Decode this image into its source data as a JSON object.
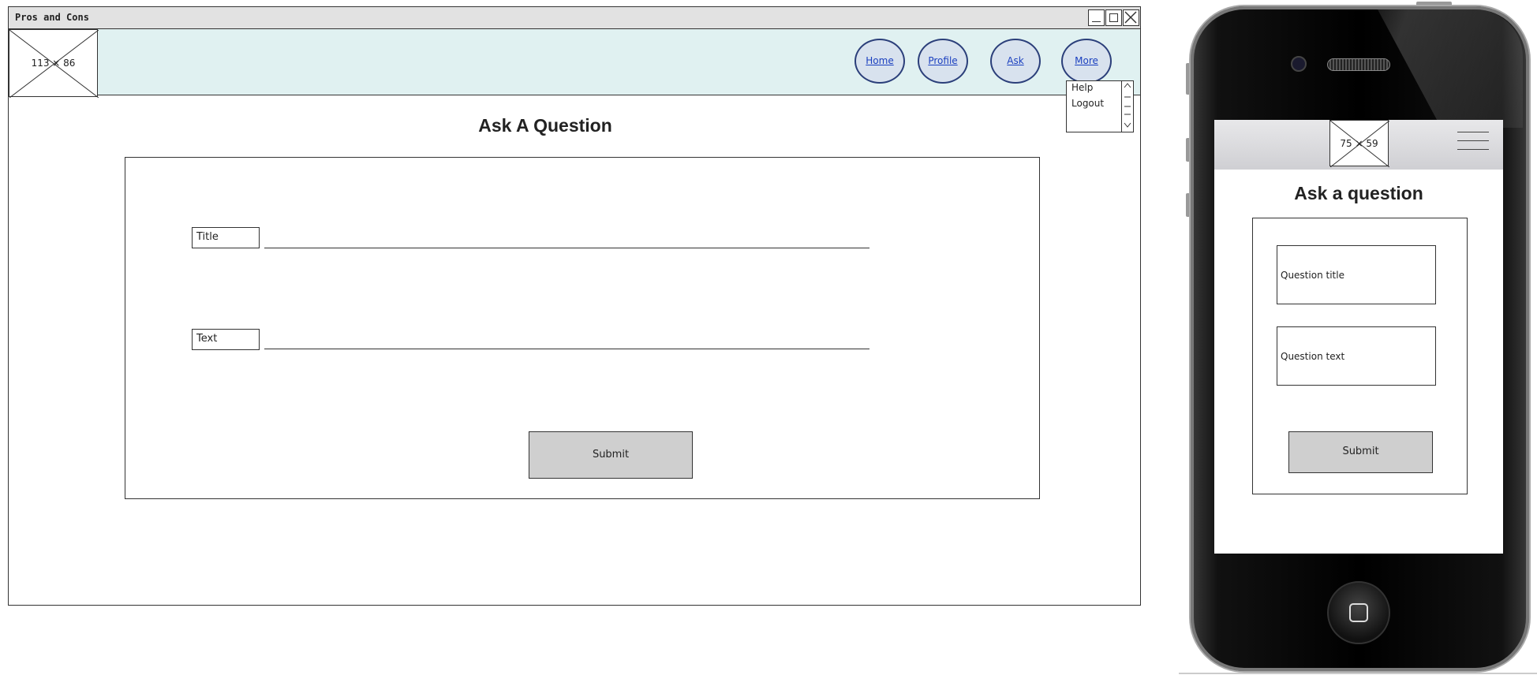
{
  "window": {
    "title": "Pros and Cons",
    "logo_placeholder": "113 × 86"
  },
  "nav": {
    "items": [
      {
        "label": "Home"
      },
      {
        "label": "Profile"
      },
      {
        "label": "Ask"
      },
      {
        "label": "More"
      }
    ],
    "more_menu": [
      "Help",
      "Logout"
    ]
  },
  "main": {
    "title": "Ask A Question",
    "fields": [
      {
        "label": "Title",
        "value": ""
      },
      {
        "label": "Text",
        "value": ""
      }
    ],
    "submit_label": "Submit"
  },
  "mobile": {
    "logo_placeholder": "75 × 59",
    "title": "Ask a question",
    "fields": [
      {
        "placeholder": "Question title"
      },
      {
        "placeholder": "Question text"
      }
    ],
    "submit_label": "Submit"
  },
  "colors": {
    "navbar_bg": "#e0f1f1",
    "nav_circle_border": "#2b3f7a",
    "link": "#1a3fbf",
    "button_bg": "#cfcfcf"
  }
}
